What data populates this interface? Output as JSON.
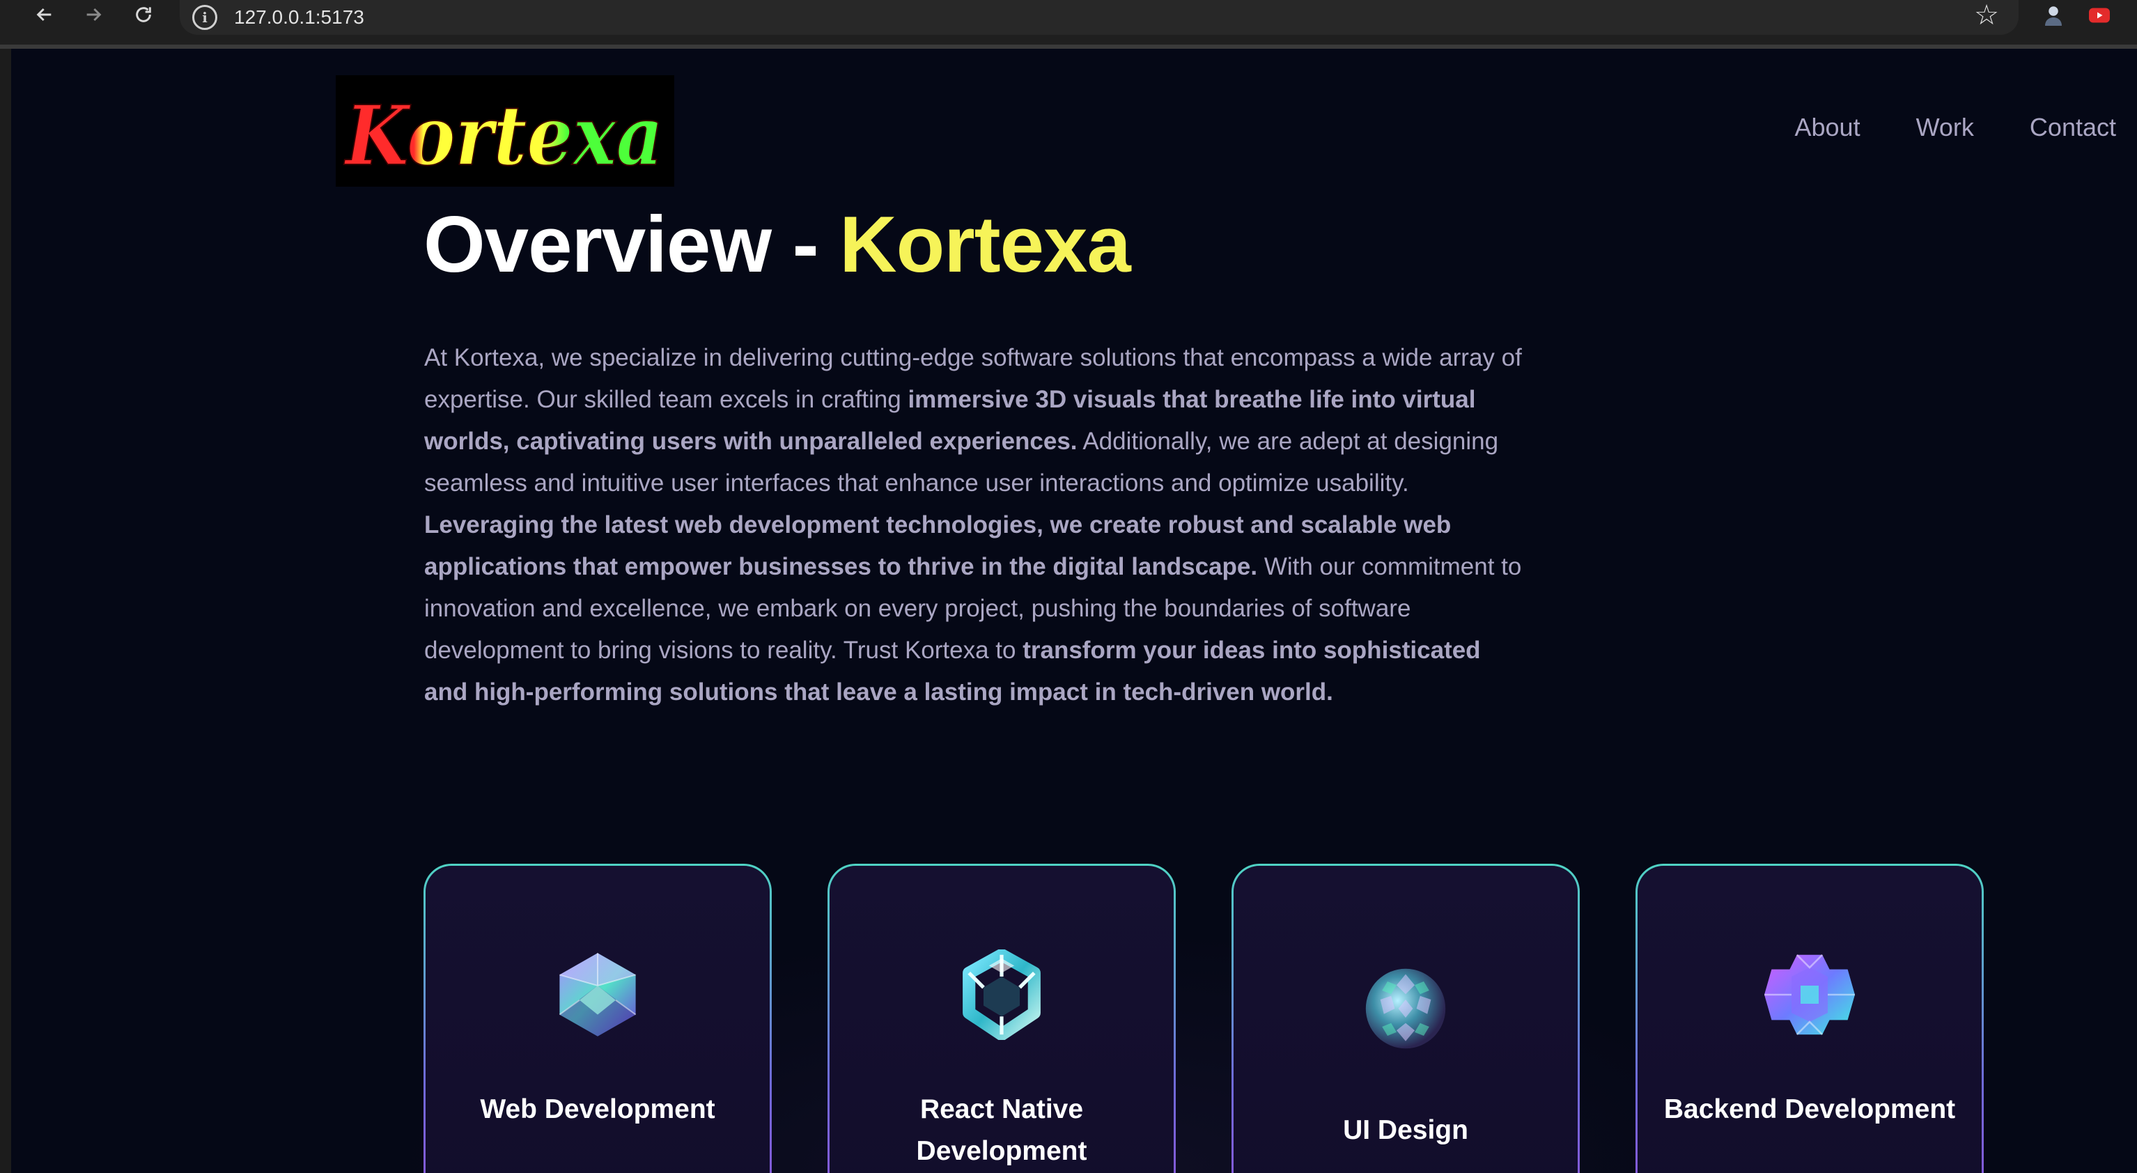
{
  "browser": {
    "url": "127.0.0.1:5173",
    "icons": [
      "back-icon",
      "forward-icon",
      "reload-icon",
      "site-info-icon",
      "bookmark-star-icon",
      "extension-icon",
      "youtube-extension-icon"
    ]
  },
  "header": {
    "logo_text": "Kortexa",
    "nav": [
      {
        "label": "About"
      },
      {
        "label": "Work"
      },
      {
        "label": "Contact"
      }
    ]
  },
  "overview": {
    "title_prefix": "Overview - ",
    "title_accent": "Kortexa",
    "segments": [
      {
        "text": "At Kortexa, we specialize in delivering cutting-edge software solutions that encompass a wide array of expertise. Our skilled team excels in crafting ",
        "bold": false
      },
      {
        "text": "immersive 3D visuals that breathe life into virtual worlds, captivating users with unparalleled experiences.",
        "bold": true
      },
      {
        "text": " Additionally, we are adept at designing seamless and intuitive user interfaces that enhance user interactions and optimize usability. ",
        "bold": false
      },
      {
        "text": "Leveraging the latest web development technologies, we create robust and scalable web applications that empower businesses to thrive in the digital landscape.",
        "bold": true
      },
      {
        "text": " With our commitment to innovation and excellence, we embark on every project, pushing the boundaries of software development to bring visions to reality. Trust Kortexa to ",
        "bold": false
      },
      {
        "text": "transform your ideas into sophisticated and high-performing solutions that leave a lasting impact in tech-driven world.",
        "bold": true
      }
    ]
  },
  "services": [
    {
      "title": "Web Development",
      "icon": "crystal-icosahedron-icon"
    },
    {
      "title": "React Native Development",
      "icon": "crystal-cube-icon"
    },
    {
      "title": "UI Design",
      "icon": "crystal-sphere-icon"
    },
    {
      "title": "Backend Development",
      "icon": "crystal-cross-icon"
    }
  ],
  "colors": {
    "background": "#050816",
    "accent_yellow": "#f6f359",
    "secondary_text": "#aaa6c3",
    "card_border_top": "#4fd3c4",
    "card_border_bottom": "#8d52d8",
    "card_fill": "#151030"
  }
}
